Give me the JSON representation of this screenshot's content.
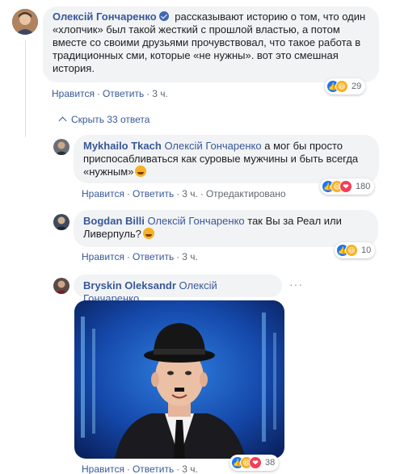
{
  "comments": [
    {
      "author": "Олексій Гончаренко",
      "verified": true,
      "text": "рассказывают историю о том, что один «хлопчик» был такой жесткий с прошлой властью, а потом вместе со своими друзьями прочувствовал, что такое работа в традиционных сми, которые «не нужны». вот это смешная история.",
      "actions": {
        "like": "Нравится",
        "reply": "Ответить",
        "time": "3 ч."
      },
      "reactions": {
        "icons": [
          "like-icon",
          "haha-icon"
        ],
        "count": "29"
      }
    }
  ],
  "replies_toggle": "Скрыть 33 ответа",
  "replies": [
    {
      "author": "Mykhailo Tkach",
      "mention": "Олексій Гончаренко",
      "text": "а мог бы просто приспосабливаться как суровые мужчины и быть всегда «нужным»",
      "emoji": "smiling-emoji",
      "actions": {
        "like": "Нравится",
        "reply": "Ответить",
        "time": "3 ч.",
        "edited": "Отредактировано"
      },
      "reactions": {
        "icons": [
          "like-icon",
          "haha-icon",
          "love-icon"
        ],
        "count": "180"
      }
    },
    {
      "author": "Bogdan Billi",
      "mention": "Олексій Гончаренко",
      "text": "так Вы за Реал или Ливерпуль?",
      "emoji": "laughing-emoji",
      "actions": {
        "like": "Нравится",
        "reply": "Ответить",
        "time": "3 ч."
      },
      "reactions": {
        "icons": [
          "like-icon",
          "haha-icon"
        ],
        "count": "10"
      }
    },
    {
      "author": "Bryskin Oleksandr",
      "mention": "Олексій Гончаренко",
      "more": "···",
      "actions": {
        "like": "Нравится",
        "reply": "Ответить",
        "time": "3 ч."
      },
      "reactions": {
        "icons": [
          "like-icon",
          "haha-icon",
          "love-icon"
        ],
        "count": "38"
      }
    }
  ],
  "colors": {
    "link": "#385898",
    "bubble": "#f2f3f5",
    "meta": "#606770",
    "like": "#1877f2",
    "haha": "#f7b125",
    "love": "#f33e58"
  }
}
